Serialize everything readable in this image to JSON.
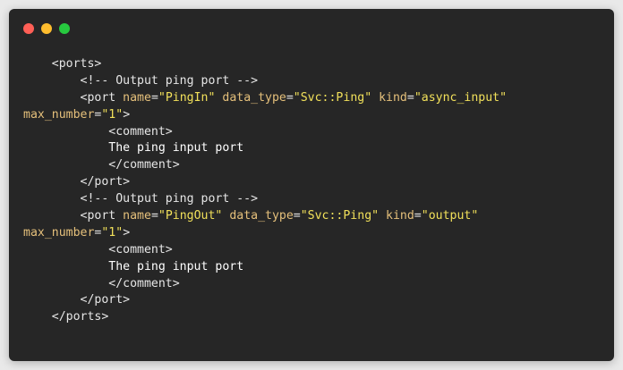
{
  "window": {
    "controls": {
      "close_color": "#ff5f56",
      "minimize_color": "#ffbd2e",
      "maximize_color": "#27c93f"
    }
  },
  "code": {
    "lines": [
      {
        "indent": "    ",
        "tokens": [
          {
            "type": "tag",
            "text": "<ports>"
          }
        ]
      },
      {
        "indent": "        ",
        "tokens": [
          {
            "type": "comment",
            "text": "<!-- Output ping port -->"
          }
        ]
      },
      {
        "indent": "        ",
        "tokens": [
          {
            "type": "tag",
            "text": "<port "
          },
          {
            "type": "attr",
            "text": "name"
          },
          {
            "type": "eq",
            "text": "="
          },
          {
            "type": "val",
            "text": "\"PingIn\""
          },
          {
            "type": "tag",
            "text": " "
          },
          {
            "type": "attr",
            "text": "data_type"
          },
          {
            "type": "eq",
            "text": "="
          },
          {
            "type": "val",
            "text": "\"Svc::Ping\""
          },
          {
            "type": "tag",
            "text": " "
          },
          {
            "type": "attr",
            "text": "kind"
          },
          {
            "type": "eq",
            "text": "="
          },
          {
            "type": "val",
            "text": "\"async_input\""
          }
        ]
      },
      {
        "indent": "",
        "tokens": [
          {
            "type": "attr",
            "text": "max_number"
          },
          {
            "type": "eq",
            "text": "="
          },
          {
            "type": "val",
            "text": "\"1\""
          },
          {
            "type": "tag",
            "text": ">"
          }
        ]
      },
      {
        "indent": "            ",
        "tokens": [
          {
            "type": "tag",
            "text": "<comment>"
          }
        ]
      },
      {
        "indent": "            ",
        "tokens": [
          {
            "type": "text",
            "text": "The ping input port"
          }
        ]
      },
      {
        "indent": "            ",
        "tokens": [
          {
            "type": "tag",
            "text": "</comment>"
          }
        ]
      },
      {
        "indent": "        ",
        "tokens": [
          {
            "type": "tag",
            "text": "</port>"
          }
        ]
      },
      {
        "indent": "        ",
        "tokens": [
          {
            "type": "comment",
            "text": "<!-- Output ping port -->"
          }
        ]
      },
      {
        "indent": "        ",
        "tokens": [
          {
            "type": "tag",
            "text": "<port "
          },
          {
            "type": "attr",
            "text": "name"
          },
          {
            "type": "eq",
            "text": "="
          },
          {
            "type": "val",
            "text": "\"PingOut\""
          },
          {
            "type": "tag",
            "text": " "
          },
          {
            "type": "attr",
            "text": "data_type"
          },
          {
            "type": "eq",
            "text": "="
          },
          {
            "type": "val",
            "text": "\"Svc::Ping\""
          },
          {
            "type": "tag",
            "text": " "
          },
          {
            "type": "attr",
            "text": "kind"
          },
          {
            "type": "eq",
            "text": "="
          },
          {
            "type": "val",
            "text": "\"output\""
          }
        ]
      },
      {
        "indent": "",
        "tokens": [
          {
            "type": "attr",
            "text": "max_number"
          },
          {
            "type": "eq",
            "text": "="
          },
          {
            "type": "val",
            "text": "\"1\""
          },
          {
            "type": "tag",
            "text": ">"
          }
        ]
      },
      {
        "indent": "            ",
        "tokens": [
          {
            "type": "tag",
            "text": "<comment>"
          }
        ]
      },
      {
        "indent": "            ",
        "tokens": [
          {
            "type": "text",
            "text": "The ping input port"
          }
        ]
      },
      {
        "indent": "            ",
        "tokens": [
          {
            "type": "tag",
            "text": "</comment>"
          }
        ]
      },
      {
        "indent": "        ",
        "tokens": [
          {
            "type": "tag",
            "text": "</port>"
          }
        ]
      },
      {
        "indent": "    ",
        "tokens": [
          {
            "type": "tag",
            "text": "</ports>"
          }
        ]
      }
    ]
  }
}
